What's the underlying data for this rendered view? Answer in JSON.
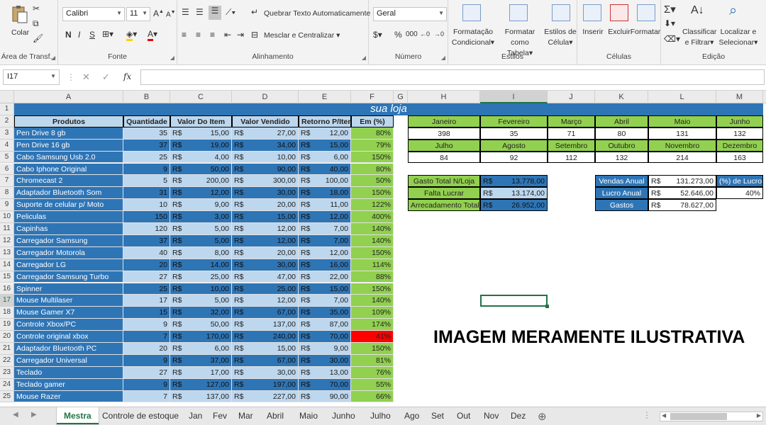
{
  "ribbon": {
    "clipboard": {
      "paste_label": "Colar",
      "group_label": "Área de Transf..."
    },
    "font": {
      "name": "Calibri",
      "size": "11",
      "bold": "N",
      "italic": "I",
      "underline": "S",
      "group_label": "Fonte"
    },
    "alignment": {
      "wrap_label": "Quebrar Texto Automaticamente",
      "merge_label": "Mesclar e Centralizar",
      "group_label": "Alinhamento"
    },
    "number": {
      "format": "Geral",
      "currency": "$",
      "percent": "%",
      "thousands": "000",
      "group_label": "Número"
    },
    "styles": {
      "conditional_l1": "Formatação",
      "conditional_l2": "Condicional",
      "table_l1": "Formatar como",
      "table_l2": "Tabela",
      "cell_l1": "Estilos de",
      "cell_l2": "Célula",
      "group_label": "Estilos"
    },
    "cells": {
      "insert": "Inserir",
      "delete": "Excluir",
      "format": "Formatar",
      "group_label": "Células"
    },
    "editing": {
      "sort_l1": "Classificar",
      "sort_l2": "e Filtrar",
      "find_l1": "Localizar e",
      "find_l2": "Selecionar",
      "group_label": "Edição"
    }
  },
  "formula_bar": {
    "name_box": "I17",
    "fx": "fx",
    "formula": ""
  },
  "columns": [
    "A",
    "B",
    "C",
    "D",
    "E",
    "F",
    "G",
    "H",
    "I",
    "J",
    "K",
    "L",
    "M"
  ],
  "selected_column": "I",
  "row_numbers": [
    "1",
    "2",
    "3",
    "4",
    "5",
    "6",
    "7",
    "8",
    "9",
    "10",
    "11",
    "12",
    "13",
    "14",
    "15",
    "16",
    "17",
    "18",
    "19",
    "20",
    "21",
    "22",
    "23",
    "24",
    "25"
  ],
  "title": "sua loja",
  "headers": {
    "produto": "Produtos",
    "qtd": "Quantidade",
    "valor_item": "Valor Do Item",
    "valor_vendido": "Valor Vendido",
    "retorno": "Retorno P/Item",
    "em": "Em (%)"
  },
  "currency_symbol": "R$",
  "products": [
    {
      "name": "Pen Drive 8 gb",
      "qtd": "35",
      "item": "15,00",
      "vendido": "27,00",
      "retorno": "12,00",
      "pct": "80%"
    },
    {
      "name": "Pen Drive 16 gb",
      "qtd": "37",
      "item": "19,00",
      "vendido": "34,00",
      "retorno": "15,00",
      "pct": "79%"
    },
    {
      "name": "Cabo Samsung Usb 2.0",
      "qtd": "25",
      "item": "4,00",
      "vendido": "10,00",
      "retorno": "6,00",
      "pct": "150%"
    },
    {
      "name": "Cabo Iphone Original",
      "qtd": "9",
      "item": "50,00",
      "vendido": "90,00",
      "retorno": "40,00",
      "pct": "80%"
    },
    {
      "name": "Chromecast 2",
      "qtd": "5",
      "item": "200,00",
      "vendido": "300,00",
      "retorno": "100,00",
      "pct": "50%"
    },
    {
      "name": "Adaptador Bluetooth Som",
      "qtd": "31",
      "item": "12,00",
      "vendido": "30,00",
      "retorno": "18,00",
      "pct": "150%"
    },
    {
      "name": "Suporte de celular p/ Moto",
      "qtd": "10",
      "item": "9,00",
      "vendido": "20,00",
      "retorno": "11,00",
      "pct": "122%"
    },
    {
      "name": "Peliculas",
      "qtd": "150",
      "item": "3,00",
      "vendido": "15,00",
      "retorno": "12,00",
      "pct": "400%"
    },
    {
      "name": "Capinhas",
      "qtd": "120",
      "item": "5,00",
      "vendido": "12,00",
      "retorno": "7,00",
      "pct": "140%"
    },
    {
      "name": "Carregador Samsung",
      "qtd": "37",
      "item": "5,00",
      "vendido": "12,00",
      "retorno": "7,00",
      "pct": "140%"
    },
    {
      "name": "Carregador Motorola",
      "qtd": "40",
      "item": "8,00",
      "vendido": "20,00",
      "retorno": "12,00",
      "pct": "150%"
    },
    {
      "name": "Carregador LG",
      "qtd": "20",
      "item": "14,00",
      "vendido": "30,00",
      "retorno": "16,00",
      "pct": "114%"
    },
    {
      "name": "Carregador Samsung Turbo",
      "qtd": "27",
      "item": "25,00",
      "vendido": "47,00",
      "retorno": "22,00",
      "pct": "88%"
    },
    {
      "name": "Spinner",
      "qtd": "25",
      "item": "10,00",
      "vendido": "25,00",
      "retorno": "15,00",
      "pct": "150%"
    },
    {
      "name": "Mouse Multilaser",
      "qtd": "17",
      "item": "5,00",
      "vendido": "12,00",
      "retorno": "7,00",
      "pct": "140%"
    },
    {
      "name": "Mouse Gamer X7",
      "qtd": "15",
      "item": "32,00",
      "vendido": "67,00",
      "retorno": "35,00",
      "pct": "109%"
    },
    {
      "name": "Controle Xbox/PC",
      "qtd": "9",
      "item": "50,00",
      "vendido": "137,00",
      "retorno": "87,00",
      "pct": "174%"
    },
    {
      "name": "Controle original xbox",
      "qtd": "7",
      "item": "170,00",
      "vendido": "240,00",
      "retorno": "70,00",
      "pct": "41%"
    },
    {
      "name": "Adaptador Bluetooth PC",
      "qtd": "20",
      "item": "6,00",
      "vendido": "15,00",
      "retorno": "9,00",
      "pct": "150%"
    },
    {
      "name": "Carregador Universal",
      "qtd": "9",
      "item": "37,00",
      "vendido": "67,00",
      "retorno": "30,00",
      "pct": "81%"
    },
    {
      "name": "Teclado",
      "qtd": "27",
      "item": "17,00",
      "vendido": "30,00",
      "retorno": "13,00",
      "pct": "76%"
    },
    {
      "name": "Teclado gamer",
      "qtd": "9",
      "item": "127,00",
      "vendido": "197,00",
      "retorno": "70,00",
      "pct": "55%"
    },
    {
      "name": "Mouse Razer",
      "qtd": "7",
      "item": "137,00",
      "vendido": "227,00",
      "retorno": "90,00",
      "pct": "66%"
    }
  ],
  "months_row1": [
    {
      "m": "Janeiro",
      "v": "398"
    },
    {
      "m": "Fevereiro",
      "v": "35"
    },
    {
      "m": "Março",
      "v": "71"
    },
    {
      "m": "Abril",
      "v": "80"
    },
    {
      "m": "Maio",
      "v": "131"
    },
    {
      "m": "Junho",
      "v": "132"
    }
  ],
  "months_row2": [
    {
      "m": "Julho",
      "v": "84"
    },
    {
      "m": "Agosto",
      "v": "92"
    },
    {
      "m": "Setembro",
      "v": "112"
    },
    {
      "m": "Outubro",
      "v": "132"
    },
    {
      "m": "Novembro",
      "v": "214"
    },
    {
      "m": "Dezembro",
      "v": "163"
    }
  ],
  "summary_left": [
    {
      "label": "Gasto Total  N/Loja",
      "value": "13.778,00"
    },
    {
      "label": "Falta Lucrar",
      "value": "13.174,00"
    },
    {
      "label": "Arrecadamento Total",
      "value": "26.952,00"
    }
  ],
  "summary_right": [
    {
      "label": "Vendas  Anual",
      "value": "131.273,00"
    },
    {
      "label": "Lucro  Anual",
      "value": "52.646,00"
    },
    {
      "label": "Gastos",
      "value": "78.627,00"
    }
  ],
  "profit_pct_label": "(%) de Lucro",
  "profit_pct_value": "40%",
  "note": "IMAGEM MERAMENTE ILUSTRATIVA",
  "tabs": [
    "Mestra",
    "Controle de estoque",
    "Jan",
    "Fev",
    "Mar",
    "Abril",
    "Maio",
    "Junho",
    "Julho",
    "Ago",
    "Set",
    "Out",
    "Nov",
    "Dez"
  ],
  "active_tab": "Mestra",
  "add_sheet": "⊕"
}
